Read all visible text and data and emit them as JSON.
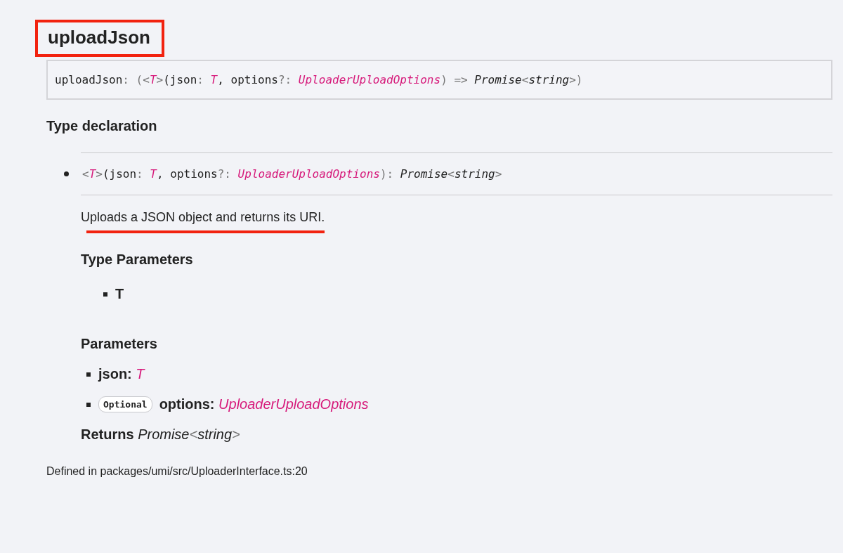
{
  "member": {
    "title": "uploadJson",
    "highlighted": true,
    "signature": [
      {
        "kind": "plain",
        "text": "uploadJson"
      },
      {
        "kind": "punct",
        "text": ": ("
      },
      {
        "kind": "punct",
        "text": "<"
      },
      {
        "kind": "type",
        "text": "T"
      },
      {
        "kind": "punct",
        "text": ">"
      },
      {
        "kind": "plain",
        "text": "(json"
      },
      {
        "kind": "punct",
        "text": ": "
      },
      {
        "kind": "type",
        "text": "T"
      },
      {
        "kind": "plain",
        "text": ", options"
      },
      {
        "kind": "punct",
        "text": "?: "
      },
      {
        "kind": "type",
        "text": "UploaderUploadOptions"
      },
      {
        "kind": "punct",
        "text": ") => "
      },
      {
        "kind": "ref",
        "text": "Promise"
      },
      {
        "kind": "punct",
        "text": "<"
      },
      {
        "kind": "ref",
        "text": "string"
      },
      {
        "kind": "punct",
        "text": ">)"
      }
    ],
    "type_declaration": {
      "heading": "Type declaration",
      "signature": [
        {
          "kind": "punct",
          "text": "<"
        },
        {
          "kind": "type",
          "text": "T"
        },
        {
          "kind": "punct",
          "text": ">"
        },
        {
          "kind": "plain",
          "text": "(json"
        },
        {
          "kind": "punct",
          "text": ": "
        },
        {
          "kind": "type",
          "text": "T"
        },
        {
          "kind": "plain",
          "text": ", options"
        },
        {
          "kind": "punct",
          "text": "?: "
        },
        {
          "kind": "type",
          "text": "UploaderUploadOptions"
        },
        {
          "kind": "punct",
          "text": "): "
        },
        {
          "kind": "ref",
          "text": "Promise"
        },
        {
          "kind": "punct",
          "text": "<"
        },
        {
          "kind": "ref",
          "text": "string"
        },
        {
          "kind": "punct",
          "text": ">"
        }
      ],
      "description": "Uploads a JSON object and returns its URI.",
      "description_underlined": true,
      "type_parameters_heading": "Type Parameters",
      "type_parameters": [
        "T"
      ],
      "parameters_heading": "Parameters",
      "parameters": [
        {
          "name": "json:",
          "type": "T",
          "optional": false
        },
        {
          "badge": "Optional",
          "name": "options:",
          "type": "UploaderUploadOptions",
          "optional": true
        }
      ],
      "returns_label": "Returns",
      "returns_type": "Promise",
      "returns_lt": "<",
      "returns_arg": "string",
      "returns_gt": ">"
    },
    "defined_in": "Defined in packages/umi/src/UploaderInterface.ts:20"
  }
}
